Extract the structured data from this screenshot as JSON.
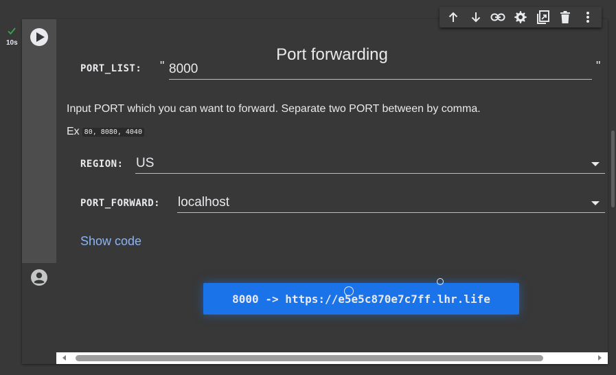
{
  "gutter": {
    "exec_time": "10s"
  },
  "toolbar": {
    "buttons": [
      "move-up-icon",
      "move-down-icon",
      "link-icon",
      "gear-icon",
      "mirror-cell-icon",
      "delete-icon",
      "more-vert-icon"
    ]
  },
  "form": {
    "title": "Port forwarding",
    "port_list": {
      "label": "PORT_LIST:",
      "value": "8000",
      "open_quote": "\"",
      "close_quote": "\""
    },
    "description": "Input PORT which you can want to forward. Separate two PORT between by comma.",
    "example_prefix": "Ex",
    "example_code": "80, 8080, 4040",
    "region": {
      "label": "REGION:",
      "value": "US"
    },
    "port_forward": {
      "label": "PORT_FORWARD:",
      "value": "localhost"
    },
    "show_code": "Show code"
  },
  "output": {
    "result": "8000 -> https://e5e5c870e7c7ff.lhr.life"
  },
  "colors": {
    "background": "#383838",
    "rail": "#4d4d4d",
    "accent": "#1a73e8",
    "link": "#8ab4f8",
    "success": "#34a853"
  }
}
